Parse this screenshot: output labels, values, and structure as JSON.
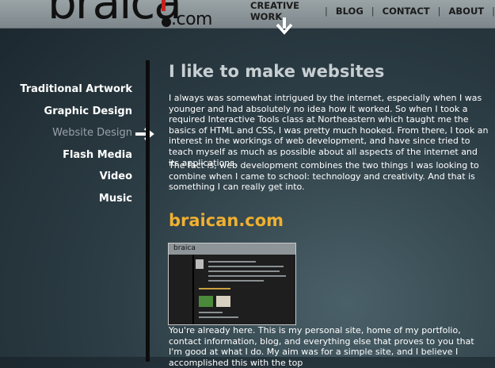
{
  "header": {
    "logo_main": "braica",
    "logo_suffix": ".com",
    "nav": [
      {
        "label": "CREATIVE WORK"
      },
      {
        "label": "BLOG"
      },
      {
        "label": "CONTACT"
      },
      {
        "label": "ABOUT"
      }
    ],
    "separator": "|"
  },
  "sidebar": {
    "items": [
      {
        "label": "Traditional Artwork"
      },
      {
        "label": "Graphic Design"
      },
      {
        "label": "Website Design"
      },
      {
        "label": "Flash Media"
      },
      {
        "label": "Video"
      },
      {
        "label": "Music"
      }
    ],
    "active_index": 2
  },
  "main": {
    "title": "I like to make websites",
    "paragraph1": "I always was somewhat intrigued by the internet, especially when I was younger and had absolutely no idea how it worked. So when I took a required Interactive Tools class at Northeastern which taught me the basics of HTML and CSS, I was pretty much hooked. From there, I took an interest in the workings of web development, and have since tried to teach myself as much as possible about all aspects of the internet and its applications.",
    "paragraph2": "The fact is, web development combines the two things I was looking to combine when I came to school: technology and creativity. And that is something I can really get into.",
    "project_title": "braican.com",
    "paragraph3": "You're already here. This is my personal site, home of my portfolio, contact information, blog, and everything else that proves to you that I'm good at what I do. My aim was for a simple site, and I believe I accomplished this with the top"
  },
  "colors": {
    "accent": "#f0b030",
    "logo_bar": "#c62020",
    "header_bg": "#8f989c"
  }
}
